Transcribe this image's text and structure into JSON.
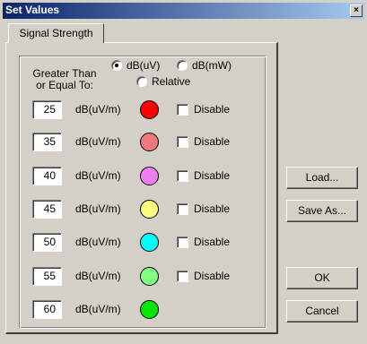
{
  "window": {
    "title": "Set Values",
    "close_glyph": "×"
  },
  "tabs": [
    {
      "label": "Signal Strength",
      "active": true
    }
  ],
  "group": {
    "label_line1": "Greater Than",
    "label_line2": "or Equal To:"
  },
  "unit_options": [
    {
      "label": "dB(uV)",
      "selected": true
    },
    {
      "label": "dB(mW)",
      "selected": false
    },
    {
      "label": "Relative",
      "selected": false
    }
  ],
  "thresholds": [
    {
      "value": "25",
      "unit": "dB(uV/m)",
      "color": "#ff0000",
      "disable_label": "Disable",
      "disabled": false
    },
    {
      "value": "35",
      "unit": "dB(uV/m)",
      "color": "#f07a7a",
      "disable_label": "Disable",
      "disabled": false
    },
    {
      "value": "40",
      "unit": "dB(uV/m)",
      "color": "#f07ef0",
      "disable_label": "Disable",
      "disabled": false
    },
    {
      "value": "45",
      "unit": "dB(uV/m)",
      "color": "#fbfb7d",
      "disable_label": "Disable",
      "disabled": false
    },
    {
      "value": "50",
      "unit": "dB(uV/m)",
      "color": "#00ffff",
      "disable_label": "Disable",
      "disabled": false
    },
    {
      "value": "55",
      "unit": "dB(uV/m)",
      "color": "#80ff80",
      "disable_label": "Disable",
      "disabled": false
    },
    {
      "value": "60",
      "unit": "dB(uV/m)",
      "color": "#00e600"
    }
  ],
  "buttons": {
    "load": "Load...",
    "save_as": "Save As...",
    "ok": "OK",
    "cancel": "Cancel"
  },
  "colors": {
    "titlebar_start": "#0a246a",
    "titlebar_end": "#a6caf0",
    "face": "#d4d0c8"
  }
}
